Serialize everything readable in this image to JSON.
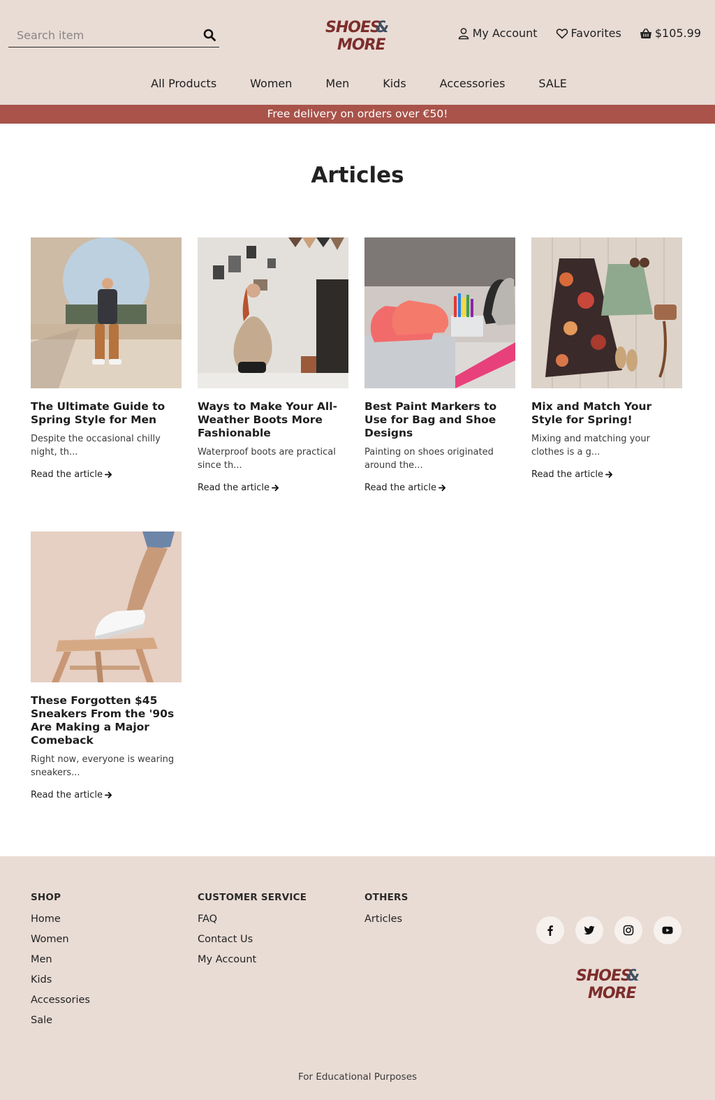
{
  "header": {
    "search_placeholder": "Search item",
    "logo_line1": "SHOES",
    "logo_amp": "&",
    "logo_line2": "MORE",
    "account_label": "My Account",
    "favorites_label": "Favorites",
    "cart_total": "$105.99"
  },
  "nav": [
    "All Products",
    "Women",
    "Men",
    "Kids",
    "Accessories",
    "SALE"
  ],
  "promo": "Free delivery on orders over €50!",
  "main": {
    "title": "Articles",
    "read_more": "Read the article",
    "articles": [
      {
        "title": "The Ultimate Guide to Spring Style for Men",
        "excerpt": "Despite the occasional chilly night, th..."
      },
      {
        "title": "Ways to Make Your All-Weather Boots More Fashionable",
        "excerpt": "Waterproof boots are practical since th..."
      },
      {
        "title": "Best Paint Markers to Use for Bag and Shoe Designs",
        "excerpt": "Painting on shoes originated around the..."
      },
      {
        "title": "Mix and Match Your Style for Spring!",
        "excerpt": "Mixing and matching your clothes is a g..."
      },
      {
        "title": "These Forgotten $45 Sneakers From the '90s Are Making a Major Comeback",
        "excerpt": "Right now, everyone is wearing sneakers..."
      }
    ]
  },
  "footer": {
    "shop": {
      "heading": "SHOP",
      "links": [
        "Home",
        "Women",
        "Men",
        "Kids",
        "Accessories",
        "Sale"
      ]
    },
    "service": {
      "heading": "CUSTOMER SERVICE",
      "links": [
        "FAQ",
        "Contact Us",
        "My Account"
      ]
    },
    "others": {
      "heading": "OTHERS",
      "links": [
        "Articles"
      ]
    },
    "socials": [
      "facebook-icon",
      "twitter-icon",
      "instagram-icon",
      "youtube-icon"
    ],
    "note": "For Educational Purposes"
  },
  "colors": {
    "header_bg": "#e9dcd5",
    "promo_bg": "#a9534a",
    "logo_red": "#7c2e2c",
    "logo_slate": "#3f4f63"
  }
}
